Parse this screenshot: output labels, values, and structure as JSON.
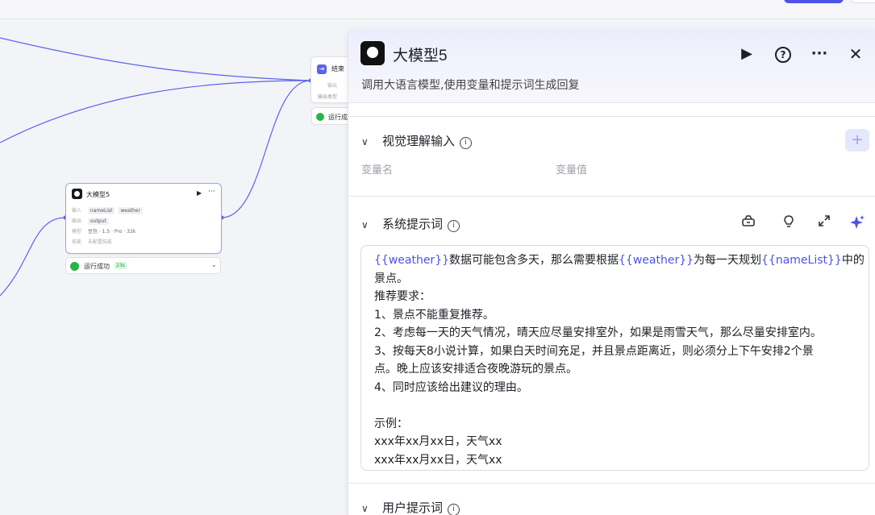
{
  "canvas": {
    "end_node": {
      "title": "结束",
      "line1": "输出",
      "line2": "输出类型",
      "status": "运行成"
    },
    "llm_node": {
      "title": "大模型5",
      "input_label": "输入",
      "inputs": [
        "nameList",
        "weather"
      ],
      "output_label": "输出",
      "output": "output",
      "model_label": "模型",
      "model": "豆包 · 1.5 · Pro · 32k",
      "skill_label": "技能",
      "skill": "未配置技能",
      "status": "运行成功",
      "time": "23s"
    }
  },
  "panel": {
    "title": "大模型5",
    "description": "调用大语言模型,使用变量和提示词生成回复",
    "vision_section": {
      "title": "视觉理解输入",
      "col_name": "变量名",
      "col_value": "变量值"
    },
    "system_prompt_section": {
      "title": "系统提示词"
    },
    "user_prompt_section": {
      "title": "用户提示词"
    },
    "prompt": {
      "l1_var1": "{{weather}}",
      "l1_t1": "数据可能包含多天，那么需要根据",
      "l1_var2": "{{weather}}",
      "l1_t2": "为每一天规划",
      "l1_var3": "{{nameList}}",
      "l1_t3": "中的",
      "l2": "景点。",
      "l3": "推荐要求：",
      "l4": "1、景点不能重复推荐。",
      "l5": "2、考虑每一天的天气情况，晴天应尽量安排室外，如果是雨雪天气，那么尽量安排室内。",
      "l6": "3、按每天8小说计算，如果白天时间充足，并且景点距离近，则必须分上下午安排2个景",
      "l7": "点。晚上应该安排适合夜晚游玩的景点。",
      "l8": "4、同时应该给出建议的理由。",
      "l9": "",
      "l10": "示例：",
      "l11": "xxx年xx月xx日，天气xx",
      "l12": "xxx年xx月xx日，天气xx"
    },
    "colors": {
      "accent": "#4d53e8",
      "success": "#28b446"
    }
  }
}
